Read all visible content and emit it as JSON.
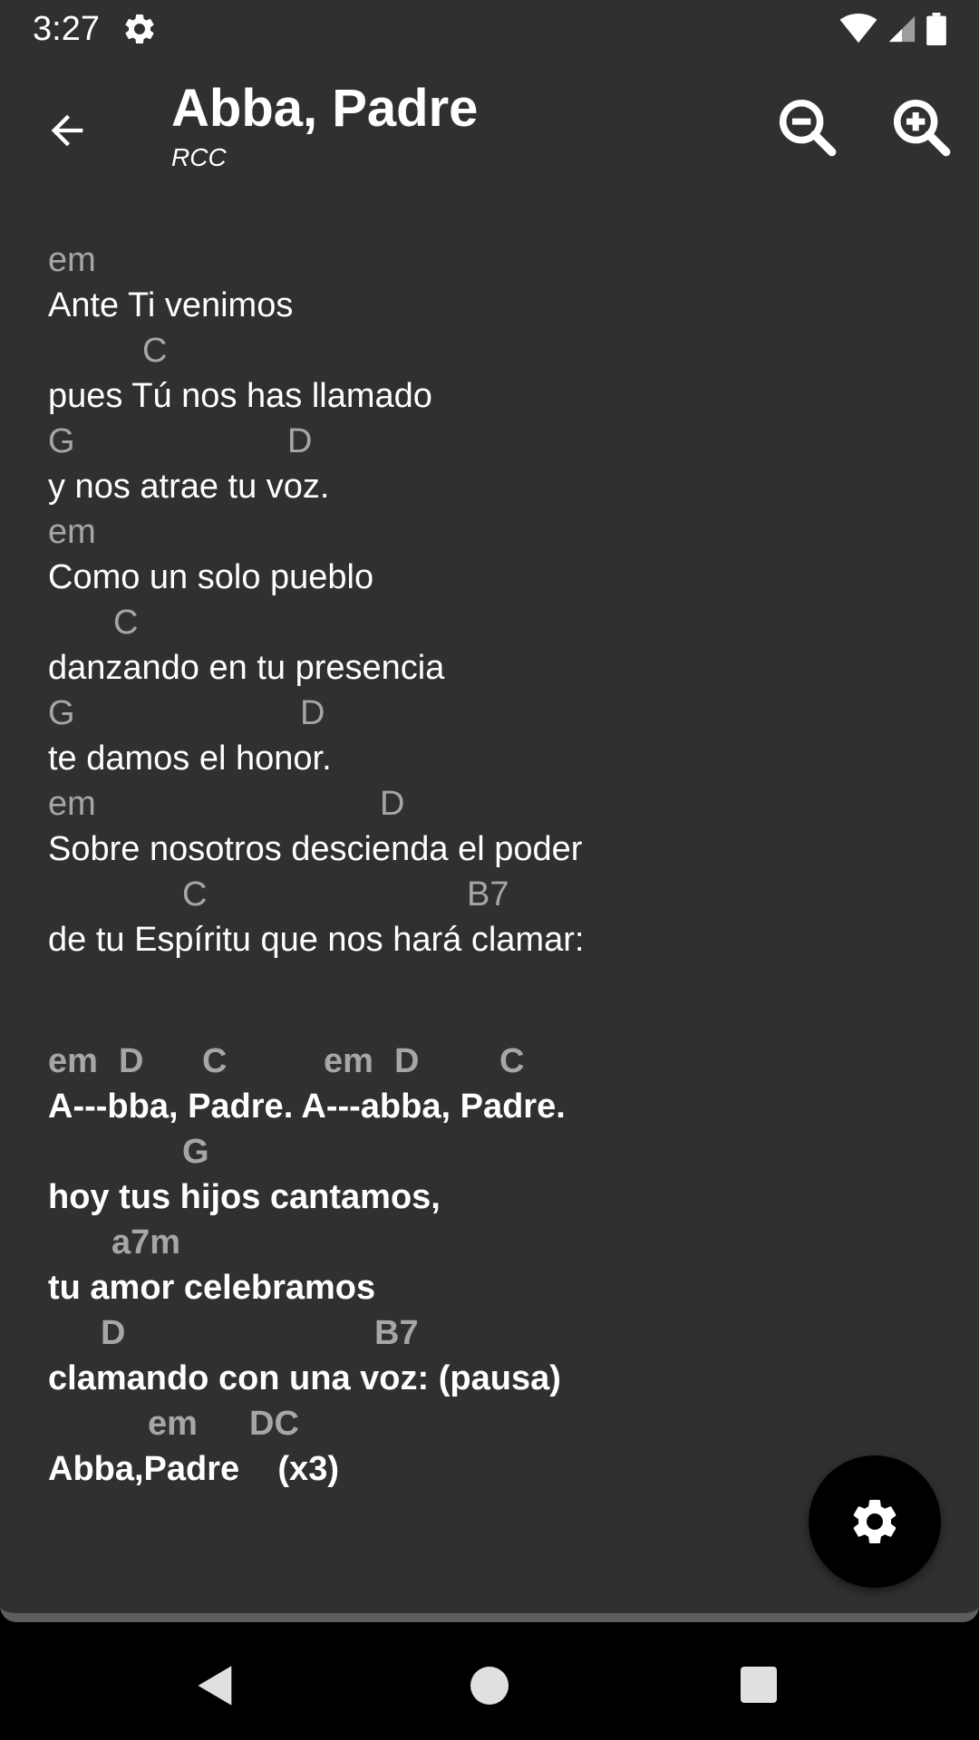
{
  "status_bar": {
    "time": "3:27",
    "icons": [
      "settings-icon",
      "wifi-icon",
      "cellular-signal-icon",
      "battery-icon"
    ]
  },
  "app_bar": {
    "title": "Abba, Padre",
    "subtitle": "RCC",
    "back_icon": "arrow-back-icon",
    "zoom_out_icon": "zoom-out-icon",
    "zoom_in_icon": "zoom-in-icon"
  },
  "colors": {
    "background": "#303030",
    "lyric_text": "#ffffff",
    "chord_text": "#a6a6a6",
    "fab": "#000000"
  },
  "verse": [
    {
      "chords": [
        {
          "name": "em"
        }
      ],
      "lyric": "Ante Ti venimos"
    },
    {
      "chords": [
        {
          "name": "C"
        }
      ],
      "lyric": "pues Tú nos has llamado"
    },
    {
      "chords": [
        {
          "name": "G"
        },
        {
          "name": "D"
        }
      ],
      "lyric": "y nos atrae tu voz."
    },
    {
      "chords": [
        {
          "name": "em"
        }
      ],
      "lyric": "Como un solo pueblo"
    },
    {
      "chords": [
        {
          "name": "C"
        }
      ],
      "lyric": "danzando en tu presencia"
    },
    {
      "chords": [
        {
          "name": "G"
        },
        {
          "name": "D"
        }
      ],
      "lyric": "te damos el honor."
    },
    {
      "chords": [
        {
          "name": "em"
        },
        {
          "name": "D"
        }
      ],
      "lyric": "Sobre nosotros descienda el poder"
    },
    {
      "chords": [
        {
          "name": "C"
        },
        {
          "name": "B7"
        }
      ],
      "lyric": "de tu Espíritu que nos hará clamar:"
    }
  ],
  "chorus": [
    {
      "chords": [
        {
          "name": "em"
        },
        {
          "name": "D"
        },
        {
          "name": "C"
        },
        {
          "name": "em"
        },
        {
          "name": "D"
        },
        {
          "name": "C"
        }
      ],
      "lyric": "A---bba, Padre. A---abba, Padre."
    },
    {
      "chords": [
        {
          "name": "G"
        }
      ],
      "lyric": "hoy tus hijos cantamos,"
    },
    {
      "chords": [
        {
          "name": "a7m"
        }
      ],
      "lyric": "tu amor celebramos"
    },
    {
      "chords": [
        {
          "name": "D"
        },
        {
          "name": "B7"
        }
      ],
      "lyric": "clamando con una voz: (pausa)"
    },
    {
      "chords": [
        {
          "name": "em"
        },
        {
          "name": "DC"
        }
      ],
      "lyric": "Abba,Padre    (x3)"
    }
  ],
  "fab": {
    "icon": "settings-icon"
  },
  "nav_bar": {
    "icons": [
      "nav-back-icon",
      "nav-home-icon",
      "nav-recents-icon"
    ]
  }
}
